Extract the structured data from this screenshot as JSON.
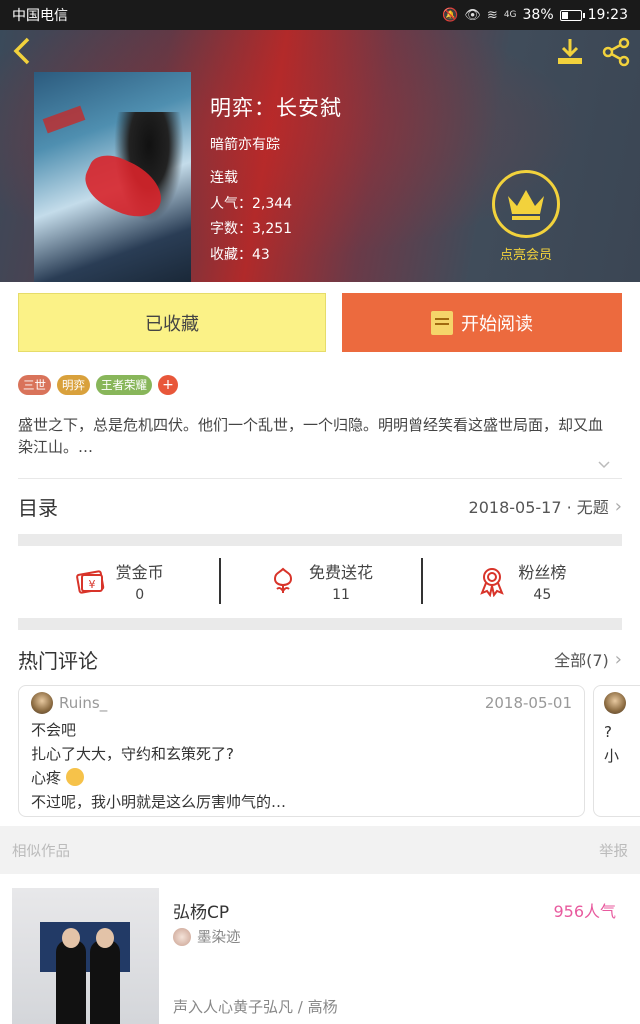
{
  "status_bar": {
    "carrier": "中国电信",
    "battery": "38%",
    "battery_level": 0.38,
    "time": "19:23",
    "network": "4G"
  },
  "book": {
    "title": "明弈：长安弑",
    "author": "暗箭亦有踪",
    "status": "连载",
    "popularity_label": "人气：2,344",
    "words_label": "字数：3,251",
    "favorites_label": "收藏：43"
  },
  "vip": {
    "label": "点亮会员"
  },
  "actions": {
    "collected_label": "已收藏",
    "read_label": "开始阅读"
  },
  "tags": [
    {
      "label": "三世",
      "color": "#d9735a"
    },
    {
      "label": "明弈",
      "color": "#d9a13c"
    },
    {
      "label": "王者荣耀",
      "color": "#88b65a"
    }
  ],
  "tag_add": "+",
  "description": "盛世之下，总是危机四伏。他们一个乱世，一个归隐。明明曾经笑看这盛世局面，却又血染江山。…",
  "toc": {
    "title": "目录",
    "latest": "2018-05-17 · 无题"
  },
  "stats": [
    {
      "name": "赏金币",
      "value": "0",
      "icon": "reward-coin-icon"
    },
    {
      "name": "免费送花",
      "value": "11",
      "icon": "flower-icon"
    },
    {
      "name": "粉丝榜",
      "value": "45",
      "icon": "medal-icon"
    }
  ],
  "hot_comments": {
    "title": "热门评论",
    "all_label": "全部(7)",
    "items": [
      {
        "user": "Ruins_",
        "date": "2018-05-01",
        "lines": [
          "不会吧",
          "扎心了大大，守约和玄策死了?",
          "心疼",
          "不过呢，我小明就是这么厉害帅气的…"
        ]
      },
      {
        "lines": [
          "?",
          "小"
        ]
      }
    ]
  },
  "similar": {
    "title": "相似作品",
    "report": "举报",
    "items": [
      {
        "title": "弘杨CP",
        "popularity": "956人气",
        "author": "墨染迹",
        "tags": "声入人心黄子弘凡 / 高杨"
      }
    ]
  },
  "colors": {
    "accent_yellow": "#f2d23c",
    "read_orange": "#ec6a3e",
    "collected_yellow": "#fbf287",
    "popularity_pink": "#e85a9e"
  }
}
